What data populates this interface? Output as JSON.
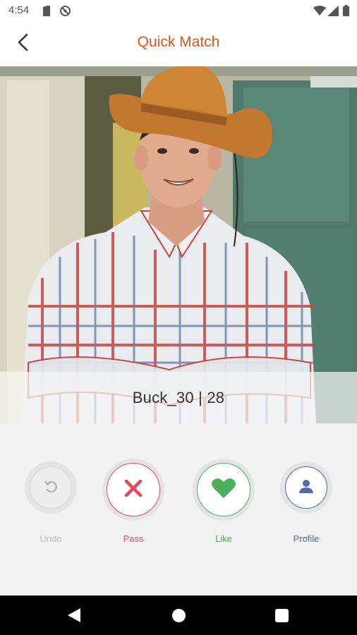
{
  "status_bar": {
    "time": "4:54",
    "icons": [
      "sim-card-icon",
      "sync-disabled-icon",
      "wifi-icon",
      "signal-icon",
      "battery-icon"
    ]
  },
  "app_bar": {
    "title": "Quick Match",
    "back_icon": "chevron-left-icon"
  },
  "profile": {
    "name_line": "Buck_30 | 28"
  },
  "actions": [
    {
      "id": "undo",
      "label": "Undo",
      "icon": "undo-icon",
      "color": "#b8b8b8"
    },
    {
      "id": "pass",
      "label": "Pass",
      "icon": "close-icon",
      "color": "#e8475b"
    },
    {
      "id": "like",
      "label": "Like",
      "icon": "heart-icon",
      "color": "#4bb05e"
    },
    {
      "id": "profile",
      "label": "Profile",
      "icon": "person-icon",
      "color": "#4f6ba8"
    }
  ],
  "nav_bar": {
    "icons": [
      "back-triangle-icon",
      "home-circle-icon",
      "recents-square-icon"
    ]
  },
  "colors": {
    "accent": "#e0531c",
    "actions_background": "#f2f2f2"
  }
}
